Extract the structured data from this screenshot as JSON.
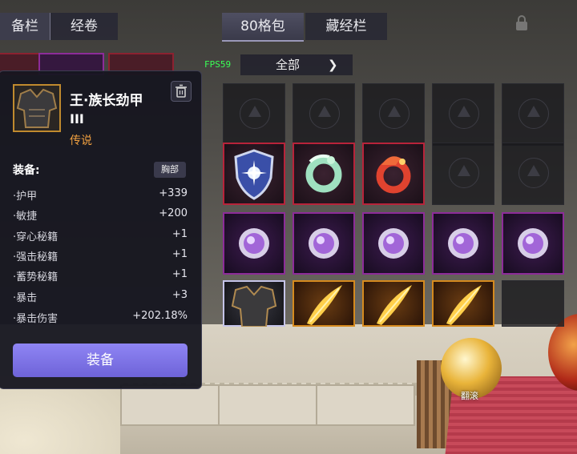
{
  "tabs": {
    "equip_tab": "备栏",
    "scripture_tab": "经卷",
    "bag_tab": "80格包",
    "store_tab": "藏经栏"
  },
  "fps": "FPS59",
  "filter": {
    "selected": "全部"
  },
  "item": {
    "name_line1": "王·族长劲甲",
    "name_line2": "III",
    "rarity": "传说",
    "section_label": "装备:",
    "slot_badge": "胸部",
    "stats": [
      {
        "label": "·护甲",
        "value": "+339"
      },
      {
        "label": "·敏捷",
        "value": "+200"
      },
      {
        "label": "·穿心秘籍",
        "value": "+1"
      },
      {
        "label": "·强击秘籍",
        "value": "+1"
      },
      {
        "label": "·蓄势秘籍",
        "value": "+1"
      },
      {
        "label": "·暴击",
        "value": "+3"
      },
      {
        "label": "·暴击伤害",
        "value": "+202.18%"
      }
    ],
    "equip_button": "装备"
  },
  "roll_label": "翻滚",
  "colors": {
    "accent_button": "#7c72e6",
    "rarity_legendary": "#f0a040",
    "fps_green": "#3aff55"
  }
}
